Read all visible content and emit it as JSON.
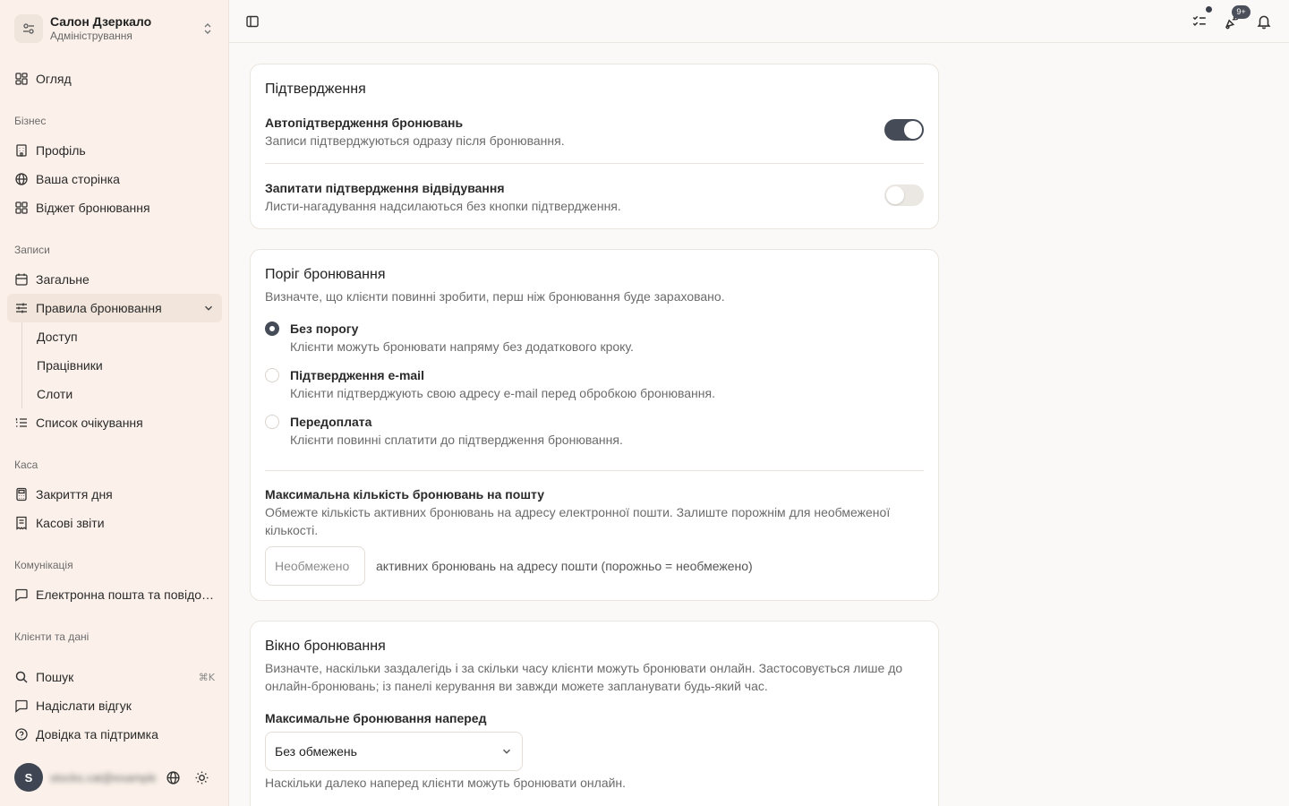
{
  "org": {
    "name": "Салон Дзеркало",
    "role": "Адміністрування"
  },
  "nav": {
    "overview": "Огляд",
    "groups": {
      "business": "Бізнес",
      "bookings": "Записи",
      "cash": "Каса",
      "communication": "Комунікація",
      "clients": "Клієнти та дані"
    },
    "business": {
      "profile": "Профіль",
      "page": "Ваша сторінка",
      "widget": "Віджет бронювання"
    },
    "bookings": {
      "general": "Загальне",
      "rules": "Правила бронювання",
      "rules_sub": [
        "Доступ",
        "Працівники",
        "Слоти"
      ],
      "waitlist": "Список очікування"
    },
    "cash": {
      "close_day": "Закриття дня",
      "reports": "Касові звіти"
    },
    "communication": {
      "email": "Електронна пошта та повідомлення"
    },
    "bottom": {
      "search": "Пошук",
      "search_kbd": "⌘K",
      "feedback": "Надіслати відгук",
      "help": "Довідка та підтримка"
    }
  },
  "user": {
    "initial": "S",
    "email": "stocks.cat@example.com"
  },
  "topbar": {
    "badge": "9+"
  },
  "confirmation": {
    "title": "Підтвердження",
    "auto": {
      "title": "Автопідтвердження бронювань",
      "desc": "Записи підтверджуються одразу після бронювання.",
      "enabled": true
    },
    "attendance": {
      "title": "Запитати підтвердження відвідування",
      "desc": "Листи-нагадування надсилаються без кнопки підтвердження.",
      "enabled": false
    }
  },
  "threshold": {
    "title": "Поріг бронювання",
    "desc": "Визначте, що клієнти повинні зробити, перш ніж бронювання буде зараховано.",
    "options": [
      {
        "title": "Без порогу",
        "desc": "Клієнти можуть бронювати напряму без додаткового кроку.",
        "checked": true
      },
      {
        "title": "Підтвердження e-mail",
        "desc": "Клієнти підтверджують свою адресу e-mail перед обробкою бронювання.",
        "checked": false
      },
      {
        "title": "Передоплата",
        "desc": "Клієнти повинні сплатити до підтвердження бронювання.",
        "checked": false
      }
    ],
    "max": {
      "title": "Максимальна кількість бронювань на пошту",
      "desc": "Обмежте кількість активних бронювань на адресу електронної пошти. Залиште порожнім для необмеженої кількості.",
      "placeholder": "Необмежено",
      "note": "активних бронювань на адресу пошти (порожньо = необмежено)"
    }
  },
  "window": {
    "title": "Вікно бронювання",
    "desc": "Визначте, наскільки заздалегідь і за скільки часу клієнти можуть бронювати онлайн. Застосовується лише до онлайн-бронювань; із панелі керування ви завжди можете запланувати будь-який час.",
    "max_ahead": {
      "label": "Максимальне бронювання наперед",
      "value": "Без обмежень",
      "hint": "Наскільки далеко наперед клієнти можуть бронювати онлайн."
    }
  }
}
